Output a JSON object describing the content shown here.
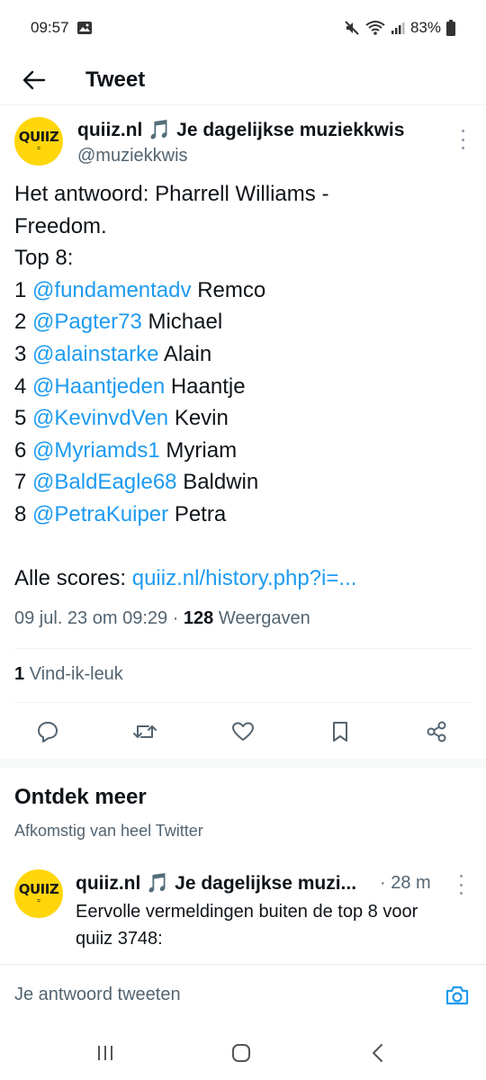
{
  "status": {
    "time": "09:57",
    "battery": "83%",
    "icons": [
      "image-icon",
      "mute-icon",
      "wifi-icon",
      "signal-icon",
      "battery-icon"
    ]
  },
  "header": {
    "title": "Tweet"
  },
  "tweet": {
    "author_name": "quiiz.nl 🎵 Je dagelijkse muziekkwis",
    "author_handle": "@muziekkwis",
    "avatar_text": "QUIIZ",
    "intro_line1": "Het antwoord: Pharrell Williams -",
    "intro_line2": "Freedom.",
    "top_label": "Top 8:",
    "ranking": [
      {
        "rank": "1",
        "mention": "@fundamentadv",
        "name": "Remco"
      },
      {
        "rank": "2",
        "mention": "@Pagter73",
        "name": "Michael"
      },
      {
        "rank": "3",
        "mention": "@alainstarke",
        "name": "Alain"
      },
      {
        "rank": "4",
        "mention": "@Haantjeden",
        "name": "Haantje"
      },
      {
        "rank": "5",
        "mention": "@KevinvdVen",
        "name": "Kevin"
      },
      {
        "rank": "6",
        "mention": "@Myriamds1",
        "name": "Myriam"
      },
      {
        "rank": "7",
        "mention": "@BaldEagle68",
        "name": "Baldwin"
      },
      {
        "rank": "8",
        "mention": "@PetraKuiper",
        "name": "Petra"
      }
    ],
    "scores_label": "Alle scores:",
    "scores_link": "quiiz.nl/history.php?i=...",
    "date": "09 jul. 23 om 09:29",
    "separator": "·",
    "views_count": "128",
    "views_label": "Weergaven",
    "likes_count": "1",
    "likes_label": "Vind-ik-leuk"
  },
  "actions": [
    "reply-icon",
    "retweet-icon",
    "like-icon",
    "bookmark-icon",
    "share-icon"
  ],
  "discover": {
    "title": "Ontdek meer",
    "subtitle": "Afkomstig van heel Twitter",
    "item": {
      "author_name": "quiiz.nl 🎵 Je dagelijkse muzi...",
      "time": "· 28 m",
      "text": "Eervolle vermeldingen buiten de top 8 voor quiiz 3748:"
    }
  },
  "reply": {
    "placeholder": "Je antwoord tweeten"
  },
  "colors": {
    "accent": "#1d9bf0",
    "avatar": "#ffd60a",
    "text": "#0f1419",
    "muted": "#536471"
  }
}
